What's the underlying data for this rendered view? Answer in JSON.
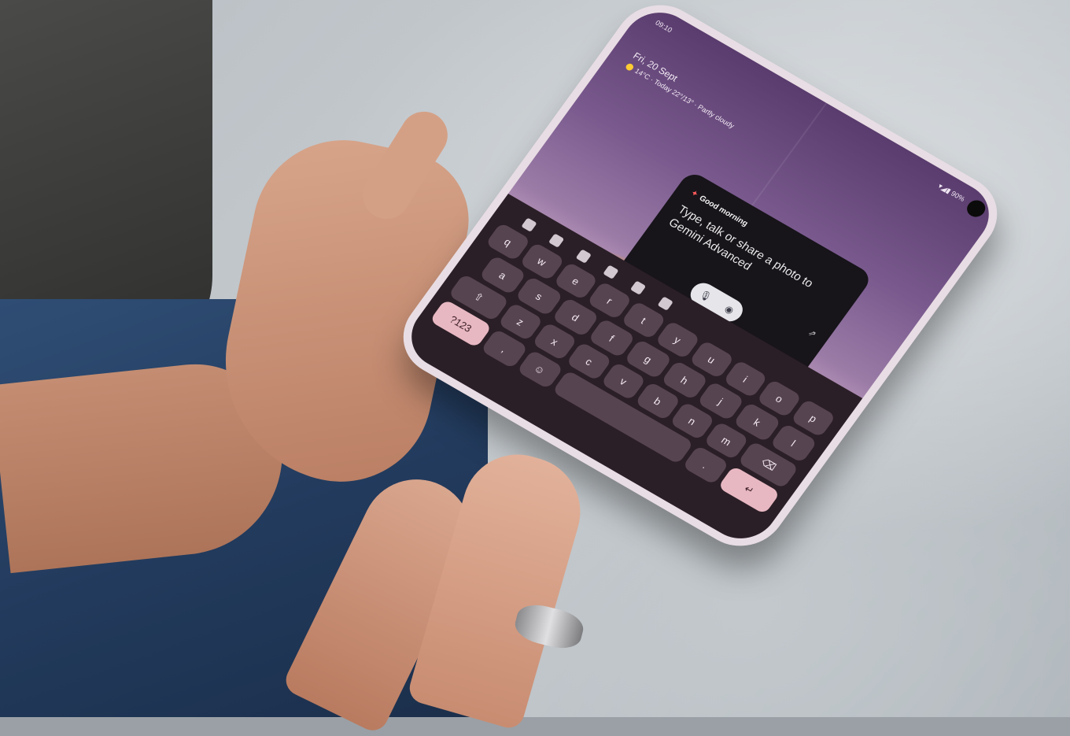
{
  "phone": {
    "status_time": "09:10",
    "status_right": "▾◢▮ 90%",
    "date": "Fri, 20 Sept",
    "weather": "14°C · Today 22°/13° · Partly cloudy"
  },
  "gemini_card": {
    "greeting": "Good morning",
    "prompt": "Type, talk or share a photo to Gemini Advanced",
    "mic_icon": "microphone-icon",
    "camera_icon": "camera-icon",
    "external_icon": "open-external-icon"
  },
  "keyboard": {
    "row1": [
      "q",
      "w",
      "e",
      "r",
      "t",
      "y",
      "u",
      "i",
      "o",
      "p"
    ],
    "row2": [
      "a",
      "s",
      "d",
      "f",
      "g",
      "h",
      "j",
      "k",
      "l"
    ],
    "row3_left": "⇧",
    "row3": [
      "z",
      "x",
      "c",
      "v",
      "b",
      "n",
      "m"
    ],
    "row3_right": "⌫",
    "row4": {
      "left": "?123",
      "comma": ",",
      "emoji": "☺",
      "period": ".",
      "enter": "↵"
    }
  },
  "colors": {
    "wallpaper_top": "#5a3c6e",
    "card_bg": "#17141a",
    "key_bg": "#574451",
    "key_accent": "#e8b8c2"
  }
}
